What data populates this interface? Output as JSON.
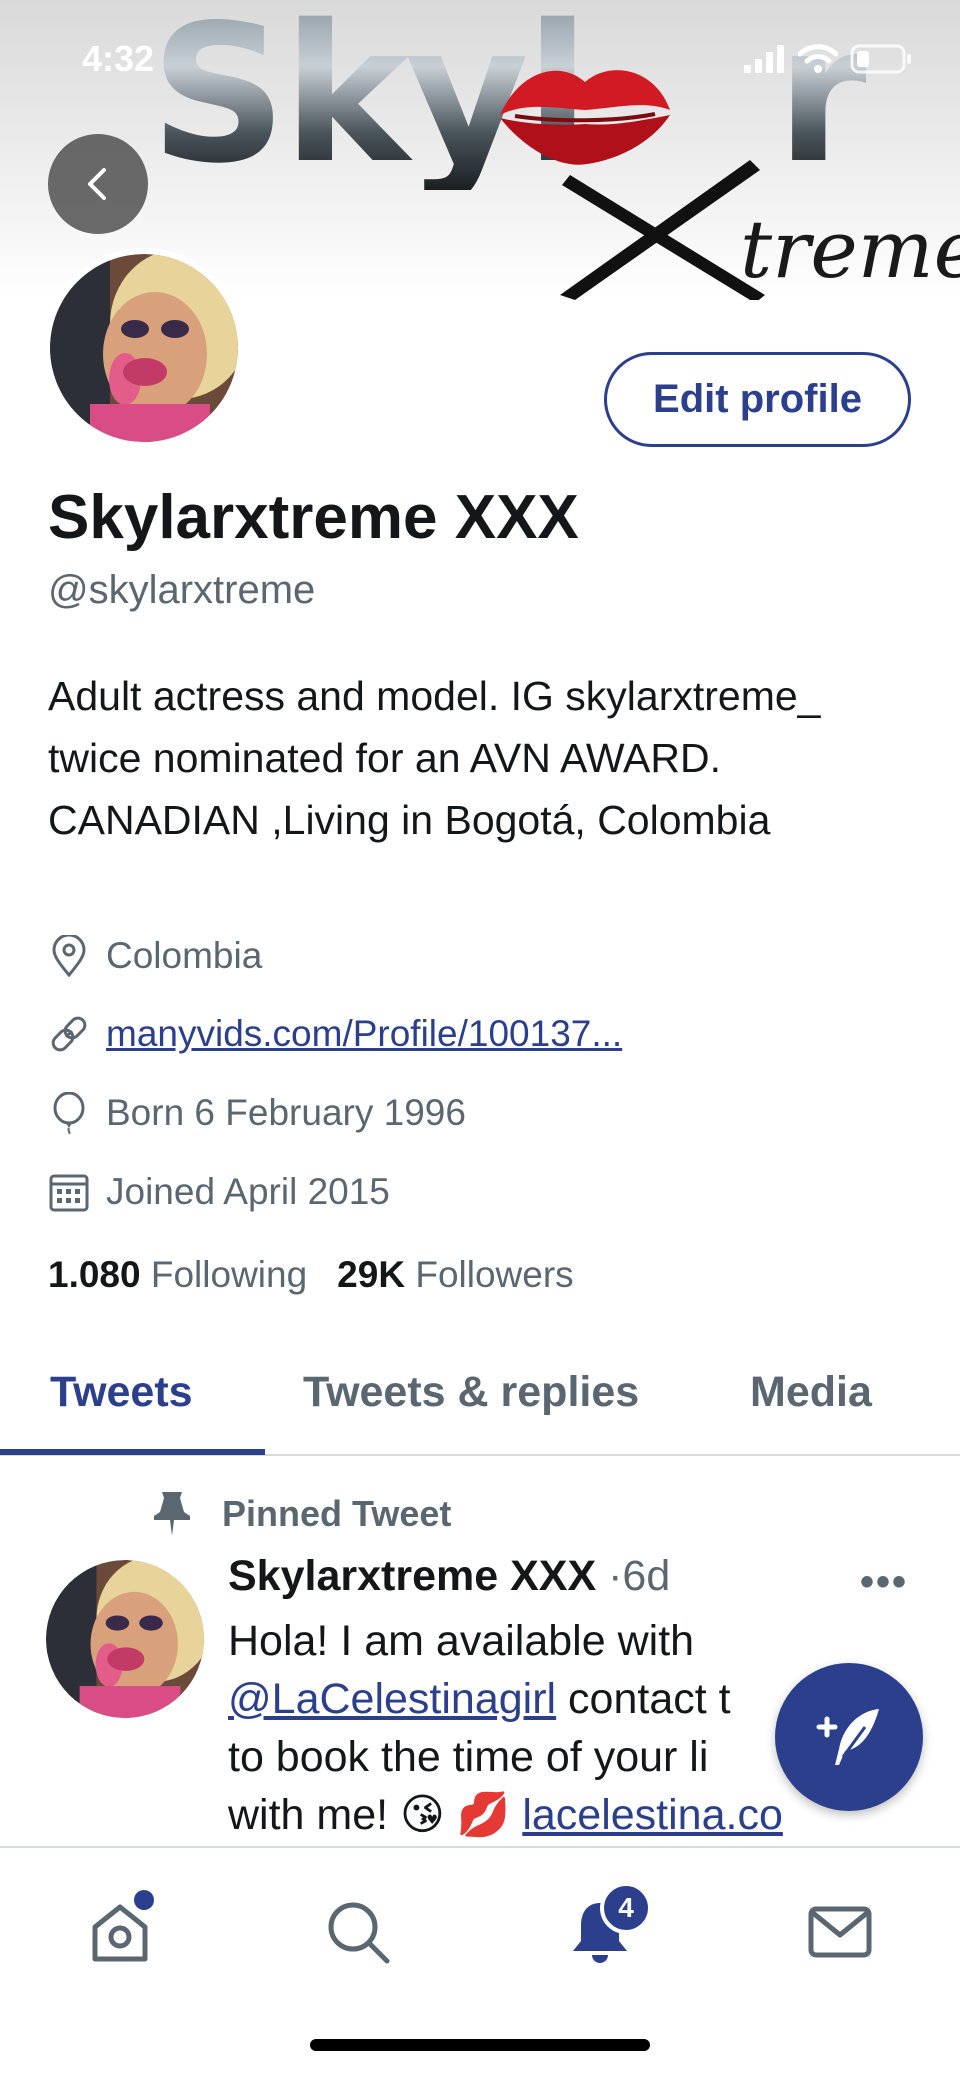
{
  "status_bar": {
    "time": "4:32"
  },
  "banner": {
    "logo_word": "Skyl",
    "logo_tail": "r",
    "logo_script": "treme"
  },
  "profile": {
    "edit_label": "Edit profile",
    "display_name": "Skylarxtreme XXX",
    "handle": "@skylarxtreme",
    "bio": "Adult actress and model. IG skylarxtreme_ twice nominated for an AVN AWARD. CANADIAN ,Living in Bogotá, Colombia",
    "location": "Colombia",
    "website": "manyvids.com/Profile/100137...",
    "birthday": "Born 6 February 1996",
    "joined": "Joined April 2015",
    "following_count": "1.080",
    "following_label": "Following",
    "followers_count": "29K",
    "followers_label": "Followers"
  },
  "tabs": [
    {
      "label": "Tweets",
      "active": true
    },
    {
      "label": "Tweets & replies",
      "active": false
    },
    {
      "label": "Media",
      "active": false
    }
  ],
  "pinned_tweet": {
    "pinned_label": "Pinned Tweet",
    "author": "Skylarxtreme XXX",
    "dot": "·",
    "age": "6d",
    "more": "•••",
    "text_1": "Hola! I am available with",
    "mention": "@LaCelestinagirl",
    "text_2": " contact t",
    "text_3": "to book the time of your li",
    "text_4": "with me! 😘 💋 ",
    "link": "lacelestina.co"
  },
  "bottom_nav": {
    "notification_badge": "4"
  },
  "colors": {
    "accent": "#2b3f8c",
    "muted": "#5b6770",
    "text": "#14171a"
  }
}
